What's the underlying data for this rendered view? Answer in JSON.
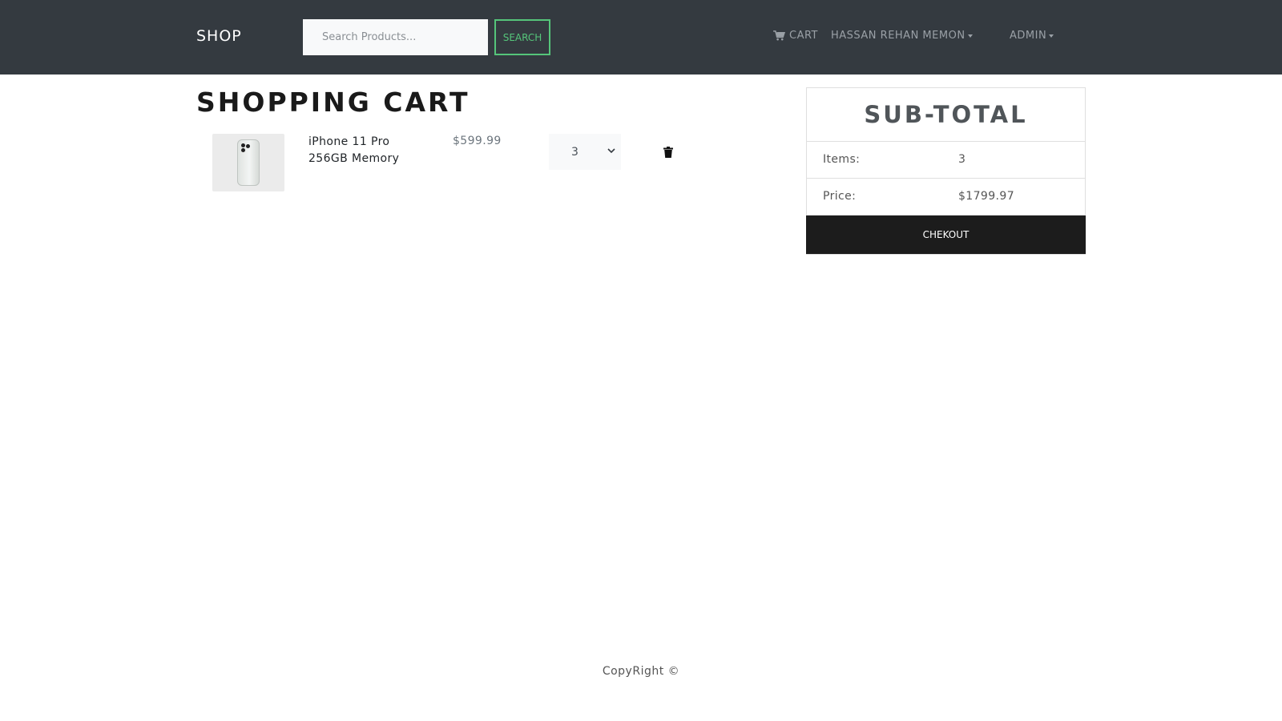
{
  "header": {
    "brand": "SHOP",
    "search_placeholder": "Search Products...",
    "search_button": "SEARCH",
    "cart_label": "CART",
    "user_label": "HASSAN REHAN MEMON",
    "admin_label": "ADMIN",
    "accent_color": "#55c57a"
  },
  "main": {
    "title": "SHOPPING CART",
    "items": [
      {
        "name": "iPhone 11 Pro 256GB Memory",
        "price": "$599.99",
        "quantity": "3"
      }
    ]
  },
  "summary": {
    "title": "SUB-TOTAL",
    "items_label": "Items:",
    "items_value": "3",
    "price_label": "Price:",
    "price_value": "$1799.97",
    "checkout_label": "CHEKOUT"
  },
  "footer": {
    "copyright": "CopyRight ©"
  }
}
